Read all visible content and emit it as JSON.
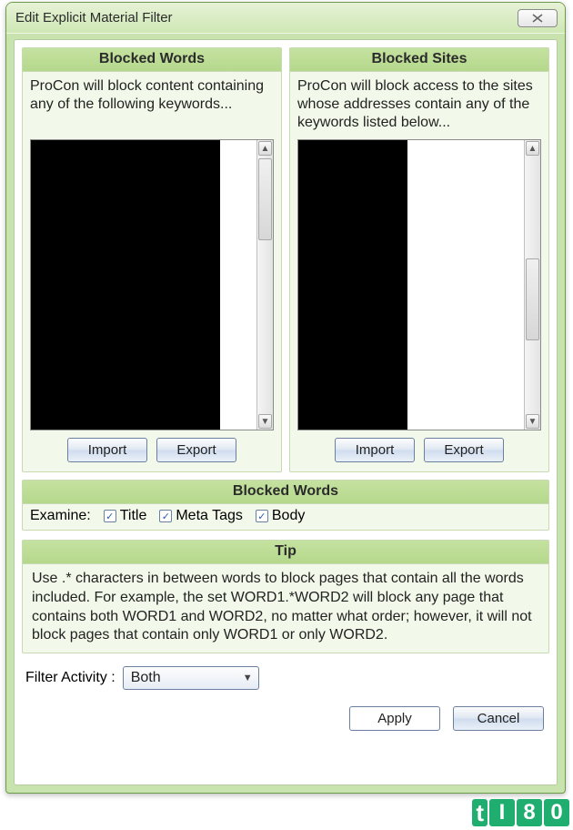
{
  "window": {
    "title": "Edit Explicit Material Filter"
  },
  "panels": {
    "blocked_words": {
      "heading": "Blocked Words",
      "description": "ProCon will block content containing any of the following keywords...",
      "import_label": "Import",
      "export_label": "Export"
    },
    "blocked_sites": {
      "heading": "Blocked Sites",
      "description": "ProCon will block access to the sites whose addresses contain any of the keywords listed below...",
      "import_label": "Import",
      "export_label": "Export"
    }
  },
  "examine": {
    "heading": "Blocked Words",
    "label": "Examine:",
    "title": {
      "label": "Title",
      "checked": true
    },
    "meta": {
      "label": "Meta Tags",
      "checked": true
    },
    "body": {
      "label": "Body",
      "checked": true
    }
  },
  "tip": {
    "heading": "Tip",
    "text": "Use .* characters in between words to block pages that contain all the words included. For example, the set WORD1.*WORD2 will block any page that contains both WORD1 and WORD2, no matter what order; however, it will not block pages that contain only WORD1 or only WORD2."
  },
  "filter": {
    "label": "Filter Activity :",
    "value": "Both"
  },
  "buttons": {
    "apply": "Apply",
    "cancel": "Cancel"
  },
  "watermark": {
    "text": "tI80"
  }
}
